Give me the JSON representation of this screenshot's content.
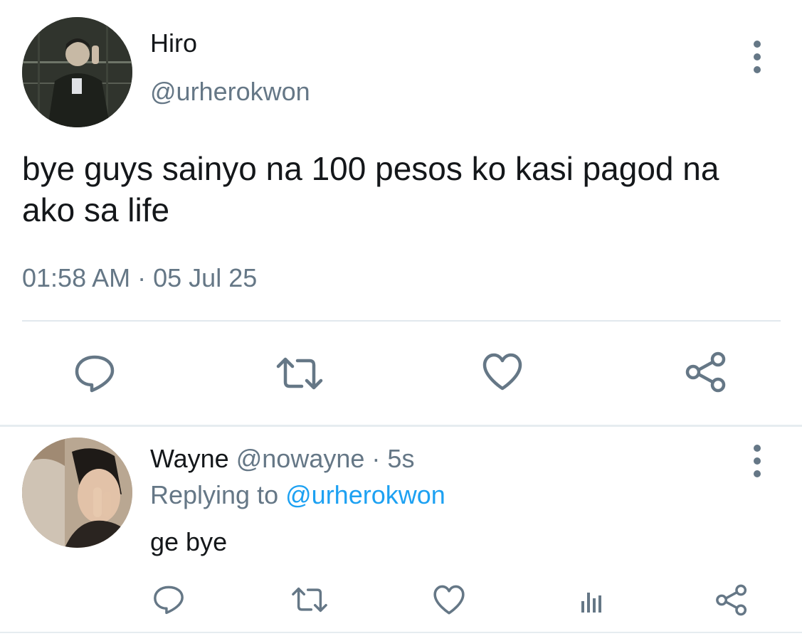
{
  "colors": {
    "primary_text": "#14171a",
    "secondary_text": "#657786",
    "link": "#1da1f2",
    "divider": "#e1e8ed"
  },
  "main_tweet": {
    "author_name": "Hiro",
    "author_handle": "@urherokwon",
    "text": "bye guys sainyo na 100 pesos ko kasi pagod na ako sa life",
    "time": "01:58 AM",
    "separator": "·",
    "date": "05 Jul 25",
    "actions": [
      "reply-icon",
      "retweet-icon",
      "like-icon",
      "share-icon"
    ]
  },
  "reply_tweet": {
    "author_name": "Wayne",
    "author_handle": "@nowayne",
    "separator": "·",
    "time_ago": "5s",
    "replying_label": "Replying to",
    "replying_handle": "@urherokwon",
    "text": "ge bye",
    "actions": [
      "reply-icon",
      "retweet-icon",
      "like-icon",
      "analytics-icon",
      "share-icon"
    ]
  }
}
